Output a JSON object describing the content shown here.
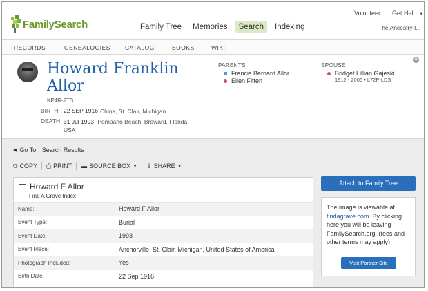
{
  "header": {
    "logo_text": "FamilySearch",
    "volunteer_label": "Volunteer",
    "get_help_label": "Get Help",
    "nav": [
      {
        "label": "Family Tree"
      },
      {
        "label": "Memories"
      },
      {
        "label": "Search"
      },
      {
        "label": "Indexing"
      }
    ],
    "active_nav": "Search",
    "ancestry_label": "The Ancestry I..."
  },
  "subnav": [
    "RECORDS",
    "GENEALOGIES",
    "CATALOG",
    "BOOKS",
    "WIKI"
  ],
  "person": {
    "name_line1": "Howard Franklin",
    "name_line2": "Allor",
    "id": "KP4R-2TS",
    "birth_label": "BIRTH",
    "birth_date": "22 SEP 1916",
    "birth_place": "China, St. Clair, Michigan",
    "death_label": "DEATH",
    "death_date": "31 Jul 1993",
    "death_place": "Pompano Beach, Broward, Florida, USA"
  },
  "family": {
    "parents_label": "PARENTS",
    "father": "Francis Bernard Allor",
    "mother": "Ellen Fitten",
    "spouse_label": "SPOUSE",
    "spouse": "Bridget Lillian Gajeski",
    "spouse_sub": "1912 - 2006 • L72P-LDS"
  },
  "goto": {
    "label": "Go To:",
    "link": "Search Results"
  },
  "toolbar": {
    "copy": "COPY",
    "print": "PRINT",
    "source_box": "SOURCE BOX",
    "share": "SHARE"
  },
  "record": {
    "title": "Howard F Allor",
    "subtitle": "Find A Grave Index",
    "rows": [
      {
        "label": "Name:",
        "value": "Howard F Allor"
      },
      {
        "label": "Event Type:",
        "value": "Burial"
      },
      {
        "label": "Event Date:",
        "value": "1993"
      },
      {
        "label": "Event Place:",
        "value": "Anchorville, St. Clair, Michigan, United States of America"
      },
      {
        "label": "Photograph Included:",
        "value": "Yes"
      },
      {
        "label": "Birth Date:",
        "value": "22 Sep 1916"
      }
    ]
  },
  "panel": {
    "attach_label": "Attach to Family Tree",
    "text_before": "The image is viewable at",
    "link": "findagrave.com",
    "text_after": ". By clicking here you will be leaving FamilySearch.org. (fees and other terms may apply)",
    "partner_button": "Visit Partner Site"
  },
  "colors": {
    "accent_blue": "#2a6fbb",
    "name_blue": "#1e5fa8",
    "logo_green": "#6a9a2a",
    "active_nav_bg": "#dce9c6",
    "male_marker": "#4e9ad6",
    "female_marker": "#d9447d"
  }
}
